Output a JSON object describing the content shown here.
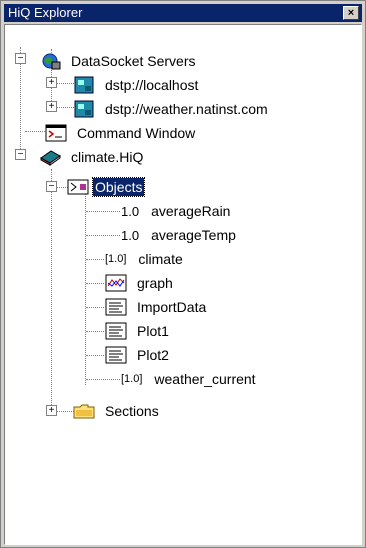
{
  "window": {
    "title": "HiQ Explorer",
    "close_glyph": "×"
  },
  "tree": {
    "datasocket": {
      "label": "DataSocket Servers",
      "icon": "globe-server-icon"
    },
    "localhost": {
      "label": "dstp://localhost",
      "icon": "server-icon"
    },
    "weather": {
      "label": "dstp://weather.natinst.com",
      "icon": "server-icon"
    },
    "command": {
      "label": "Command Window",
      "icon": "command-window-icon"
    },
    "climate": {
      "label": "climate.HiQ",
      "icon": "worksheet-icon"
    },
    "objects": {
      "label": "Objects",
      "icon": "objects-folder-icon"
    },
    "items": [
      {
        "label": "averageRain",
        "glyph": "1.0",
        "icon": "scalar-icon"
      },
      {
        "label": "averageTemp",
        "glyph": "1.0",
        "icon": "scalar-icon"
      },
      {
        "label": "climate",
        "glyph": "[1.0]",
        "icon": "matrix-icon"
      },
      {
        "label": "graph",
        "icon": "graph-icon"
      },
      {
        "label": "ImportData",
        "icon": "script-icon"
      },
      {
        "label": "Plot1",
        "icon": "script-icon"
      },
      {
        "label": "Plot2",
        "icon": "script-icon"
      },
      {
        "label": "weather_current",
        "glyph": "[1.0]",
        "icon": "matrix-icon"
      }
    ],
    "sections": {
      "label": "Sections",
      "icon": "folder-icon"
    },
    "expand_plus": "+",
    "collapse_minus": "−"
  }
}
